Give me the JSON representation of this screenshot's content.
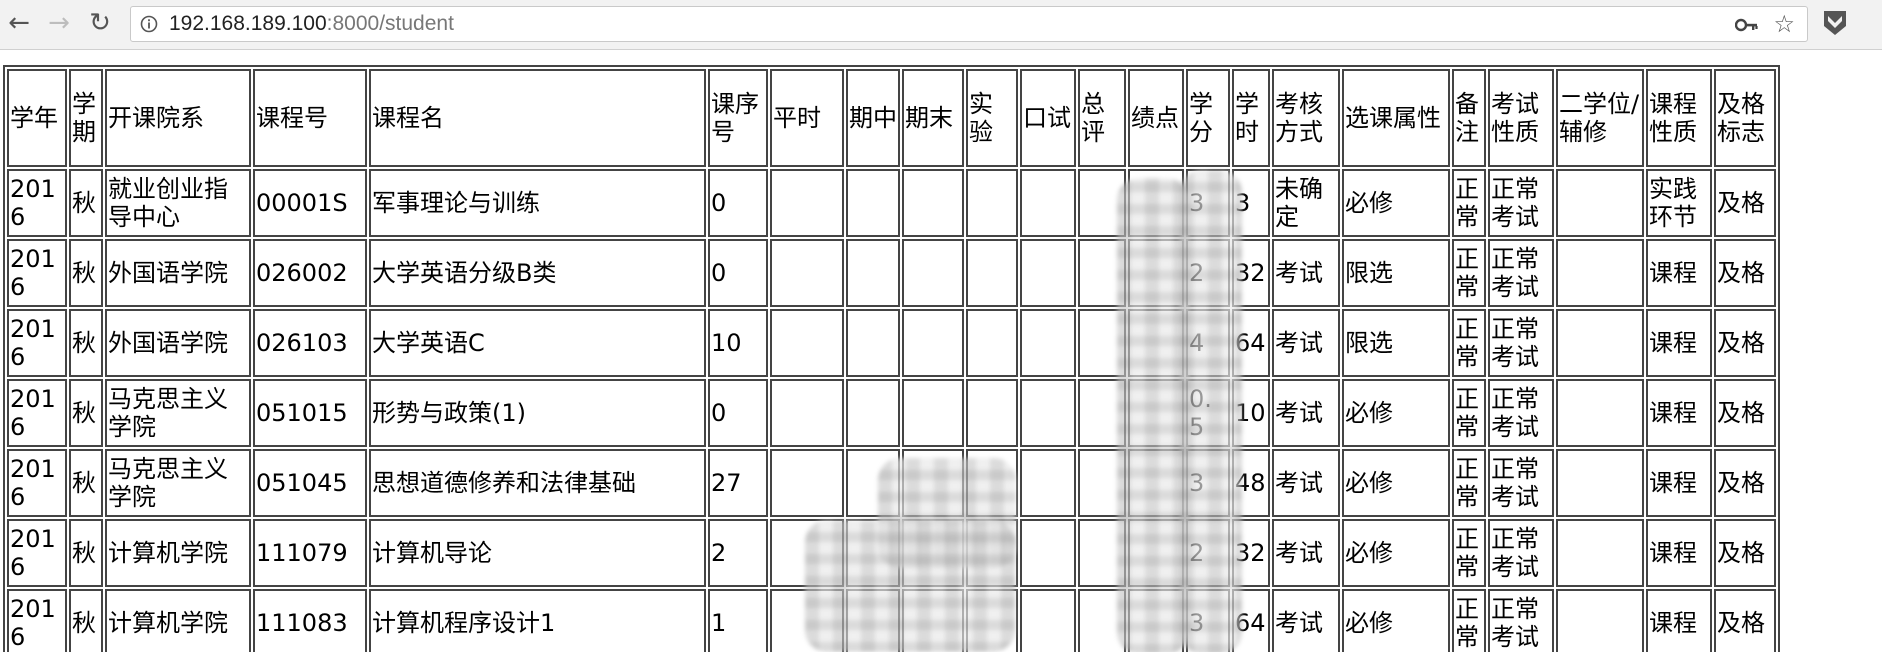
{
  "browser": {
    "url_host": "192.168.189.100",
    "url_rest": ":8000/student",
    "back_glyph": "←",
    "forward_glyph": "→",
    "reload_glyph": "↻",
    "star_glyph": "☆",
    "icons": [
      "back-arrow-icon",
      "forward-arrow-icon",
      "reload-icon",
      "info-icon",
      "key-icon",
      "star-icon",
      "extension-icon"
    ]
  },
  "table": {
    "headers": [
      "学年",
      "学期",
      "开课院系",
      "课程号",
      "课程名",
      "课序号",
      "平时",
      "期中",
      "期末",
      "实验",
      "口试",
      "总评",
      "绩点",
      "学分",
      "学时",
      "考核方式",
      "选课属性",
      "备注",
      "考试性质",
      "二学位/辅修",
      "课程性质",
      "及格标志"
    ],
    "rows": [
      [
        "2016",
        "秋",
        "就业创业指导中心",
        "00001S",
        "军事理论与训练",
        "0",
        "",
        "",
        "",
        "",
        "",
        "",
        "",
        "3",
        "3",
        "未确定",
        "必修",
        "正常",
        "正常考试",
        "",
        "实践环节",
        "及格"
      ],
      [
        "2016",
        "秋",
        "外国语学院",
        "026002",
        "大学英语分级B类",
        "0",
        "",
        "",
        "",
        "",
        "",
        "",
        "",
        "2",
        "32",
        "考试",
        "限选",
        "正常",
        "正常考试",
        "",
        "课程",
        "及格"
      ],
      [
        "2016",
        "秋",
        "外国语学院",
        "026103",
        "大学英语C",
        "10",
        "",
        "",
        "",
        "",
        "",
        "",
        "",
        "4",
        "64",
        "考试",
        "限选",
        "正常",
        "正常考试",
        "",
        "课程",
        "及格"
      ],
      [
        "2016",
        "秋",
        "马克思主义学院",
        "051015",
        "形势与政策(1)",
        "0",
        "",
        "",
        "",
        "",
        "",
        "",
        "",
        "0.5",
        "10",
        "考试",
        "必修",
        "正常",
        "正常考试",
        "",
        "课程",
        "及格"
      ],
      [
        "2016",
        "秋",
        "马克思主义学院",
        "051045",
        "思想道德修养和法律基础",
        "27",
        "",
        "",
        "",
        "",
        "",
        "",
        "",
        "3",
        "48",
        "考试",
        "必修",
        "正常",
        "正常考试",
        "",
        "课程",
        "及格"
      ],
      [
        "2016",
        "秋",
        "计算机学院",
        "111079",
        "计算机导论",
        "2",
        "",
        "",
        "",
        "",
        "",
        "",
        "",
        "2",
        "32",
        "考试",
        "必修",
        "正常",
        "正常考试",
        "",
        "课程",
        "及格"
      ],
      [
        "2016",
        "秋",
        "计算机学院",
        "111083",
        "计算机程序设计1",
        "1",
        "",
        "",
        "",
        "",
        "",
        "",
        "",
        "3",
        "64",
        "考试",
        "必修",
        "正常",
        "正常考试",
        "",
        "课程",
        "及格"
      ]
    ]
  },
  "colors": {
    "toolbar_bg": "#f2f2f2",
    "border": "#444444",
    "url_host": "#222222",
    "url_rest": "#777777"
  }
}
